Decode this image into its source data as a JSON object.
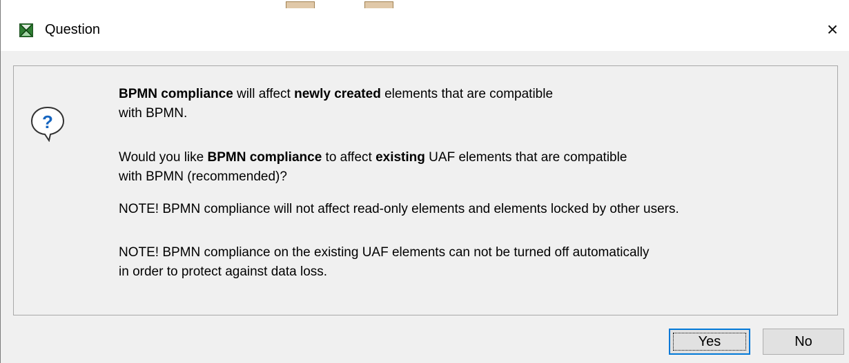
{
  "window": {
    "title": "Question",
    "close_symbol": "×",
    "icon": "app-logo-icon"
  },
  "message": {
    "icon": "question-bubble-icon",
    "p1": {
      "s1": "BPMN compliance",
      "s2": " will affect ",
      "s3": "newly created",
      "s4": " elements that are compatible",
      "line2": "with BPMN."
    },
    "p2": {
      "s1": "Would you like ",
      "s2": "BPMN compliance",
      "s3": " to affect ",
      "s4": "existing",
      "s5": " UAF elements that are compatible",
      "line2": "with BPMN (recommended)?"
    },
    "p3": "NOTE! BPMN compliance will not affect read-only elements and elements locked by other users.",
    "p4": {
      "line1": "NOTE! BPMN compliance on the existing UAF elements can not be turned off automatically",
      "line2": "in order to protect against data loss."
    }
  },
  "buttons": {
    "yes": "Yes",
    "no": "No"
  },
  "colors": {
    "dialog_bg": "#f0f0f0",
    "titlebar_bg": "#ffffff",
    "focus_border": "#0078d7"
  }
}
